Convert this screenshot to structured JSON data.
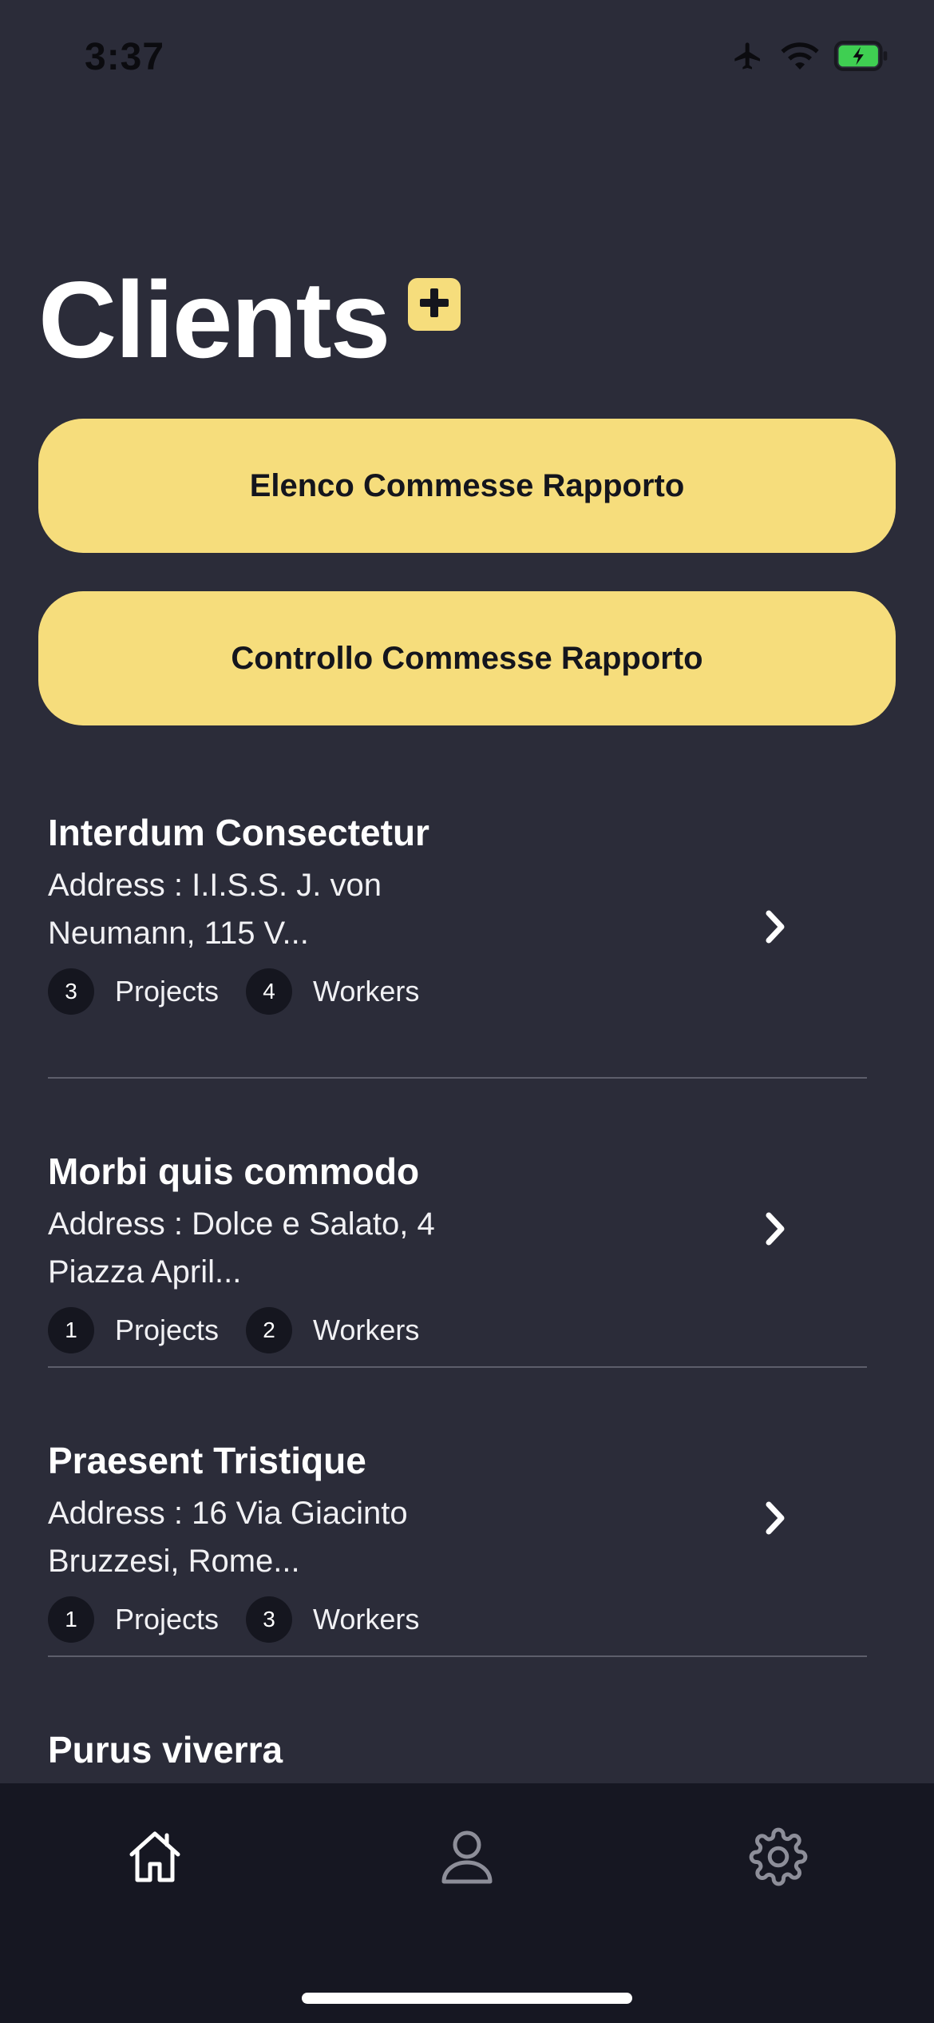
{
  "status_bar": {
    "time": "3:37",
    "icons": [
      "airplane-icon",
      "wifi-icon",
      "battery-charging-icon"
    ]
  },
  "header": {
    "title": "Clients",
    "add_icon": "plus-square-icon"
  },
  "actions": {
    "elenco_label": "Elenco Commesse Rapporto",
    "controllo_label": "Controllo Commesse Rapporto"
  },
  "clients": [
    {
      "name": "Interdum Consectetur",
      "address": "Address : I.I.S.S. J. von Neumann, 115 V...",
      "projects_count": "3",
      "projects_label": "Projects",
      "workers_count": "4",
      "workers_label": "Workers"
    },
    {
      "name": "Morbi quis commodo",
      "address": "Address : Dolce e Salato, 4 Piazza April...",
      "projects_count": "1",
      "projects_label": "Projects",
      "workers_count": "2",
      "workers_label": "Workers"
    },
    {
      "name": "Praesent Tristique",
      "address": "Address : 16 Via Giacinto Bruzzesi, Rome...",
      "projects_count": "1",
      "projects_label": "Projects",
      "workers_count": "3",
      "workers_label": "Workers"
    },
    {
      "name": "Purus viverra"
    }
  ],
  "tab_bar": {
    "tabs": [
      "home-icon",
      "profile-icon",
      "settings-icon"
    ],
    "active": "home-icon"
  },
  "colors": {
    "background": "#2b2c39",
    "accent": "#f6dd7c",
    "tab_bar": "#161722"
  }
}
